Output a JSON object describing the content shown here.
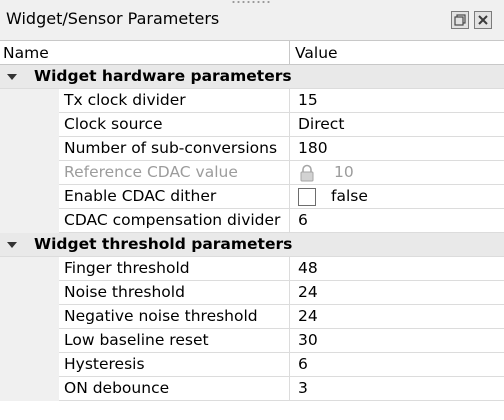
{
  "panel": {
    "title": "Widget/Sensor Parameters",
    "restore_icon": "restore-window-icon",
    "close_icon": "close-icon"
  },
  "table": {
    "columns": {
      "name": "Name",
      "value": "Value"
    },
    "groups": [
      {
        "label": "Widget hardware parameters",
        "expanded": true,
        "rows": [
          {
            "label": "Tx clock divider",
            "value": "15"
          },
          {
            "label": "Clock source",
            "value": "Direct"
          },
          {
            "label": "Number of sub-conversions",
            "value": "180"
          },
          {
            "label": "Reference CDAC value",
            "value": "10",
            "disabled": true,
            "locked": true
          },
          {
            "label": "Enable CDAC dither",
            "value": "false",
            "checkbox": true,
            "checked": false
          },
          {
            "label": "CDAC compensation divider",
            "value": "6"
          }
        ]
      },
      {
        "label": "Widget threshold parameters",
        "expanded": true,
        "rows": [
          {
            "label": "Finger threshold",
            "value": "48"
          },
          {
            "label": "Noise threshold",
            "value": "24"
          },
          {
            "label": "Negative noise threshold",
            "value": "24"
          },
          {
            "label": "Low baseline reset",
            "value": "30"
          },
          {
            "label": "Hysteresis",
            "value": "6"
          },
          {
            "label": "ON debounce",
            "value": "3"
          }
        ]
      }
    ]
  }
}
